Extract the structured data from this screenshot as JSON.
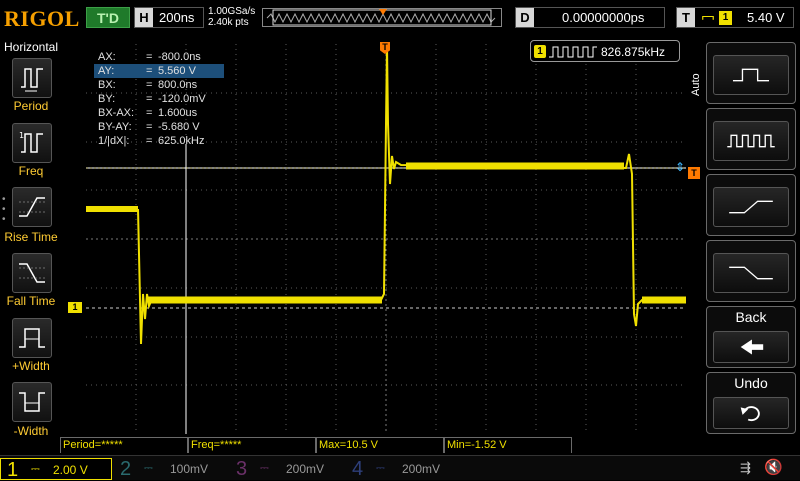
{
  "topbar": {
    "logo": "RIGOL",
    "trigger_status": "T'D",
    "horizontal": {
      "key": "H",
      "value": "200ns"
    },
    "sample_rate": "1.00GSa/s",
    "mem_depth": "2.40k pts",
    "delay": {
      "key": "D",
      "value": "0.00000000ps"
    },
    "trigger": {
      "key": "T",
      "source": "1",
      "level": "5.40 V"
    }
  },
  "left_menu": {
    "title": "Horizontal",
    "items": [
      {
        "label": "Period"
      },
      {
        "label": "Freq"
      },
      {
        "label": "Rise Time"
      },
      {
        "label": "Fall Time"
      },
      {
        "label": "+Width"
      },
      {
        "label": "-Width"
      }
    ]
  },
  "cursor_table": {
    "rows": [
      {
        "key": "AX:",
        "eq": "=",
        "value": "-800.0ns"
      },
      {
        "key": "AY:",
        "eq": "=",
        "value": "5.560 V"
      },
      {
        "key": "BX:",
        "eq": "=",
        "value": "800.0ns"
      },
      {
        "key": "BY:",
        "eq": "=",
        "value": "-120.0mV"
      },
      {
        "key": "BX-AX:",
        "eq": "=",
        "value": "1.600us"
      },
      {
        "key": "BY-AY:",
        "eq": "=",
        "value": "-5.680 V"
      },
      {
        "key": "1/|dX|:",
        "eq": "=",
        "value": "625.0kHz"
      }
    ]
  },
  "freq_badge": {
    "channel": "1",
    "value": "826.875kHz"
  },
  "markers": {
    "trigger_pos": "T",
    "channel_ground": "1",
    "trigger_level": "T"
  },
  "right_menu": {
    "auto_label": "Auto",
    "back_label": "Back",
    "undo_label": "Undo"
  },
  "measurements": {
    "period": "Period=*****",
    "freq": "Freq=*****",
    "max": "Max=10.5 V",
    "min": "Min=-1.52 V"
  },
  "channels": [
    {
      "num": "1",
      "scale": "2.00 V",
      "color": "#f0e000"
    },
    {
      "num": "2",
      "scale": "100mV",
      "color": "#00c8d2"
    },
    {
      "num": "3",
      "scale": "200mV",
      "color": "#d94fd6"
    },
    {
      "num": "4",
      "scale": "200mV",
      "color": "#3c6cff"
    }
  ]
}
